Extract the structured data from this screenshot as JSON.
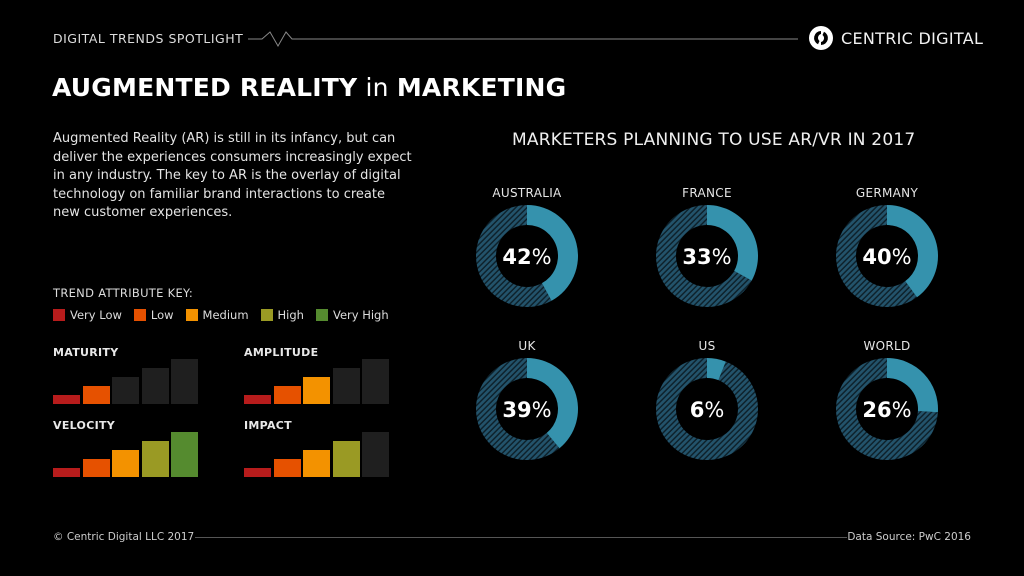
{
  "header": {
    "series_title": "DIGITAL TRENDS SPOTLIGHT",
    "brand_name": "CENTRIC DIGITAL",
    "logo_icon": "centric-digital-logo"
  },
  "title": {
    "bold1": "AUGMENTED REALITY",
    "thin": " in ",
    "bold2": "MARKETING"
  },
  "intro": "Augmented Reality (AR) is still in its infancy, but can deliver the experiences consumers increasingly expect in any industry. The key to AR is the overlay of digital technology on familiar brand interactions to create new customer experiences.",
  "key": {
    "title": "TREND ATTRIBUTE KEY:",
    "levels": [
      {
        "label": "Very Low",
        "color": "#b71c1c"
      },
      {
        "label": "Low",
        "color": "#e65100"
      },
      {
        "label": "Medium",
        "color": "#f39200"
      },
      {
        "label": "High",
        "color": "#9a9a24"
      },
      {
        "label": "Very High",
        "color": "#558b2f"
      }
    ],
    "inactive_color": "#1f1f1f"
  },
  "attributes": [
    {
      "name": "MATURITY",
      "level": 2
    },
    {
      "name": "AMPLITUDE",
      "level": 3
    },
    {
      "name": "VELOCITY",
      "level": 5
    },
    {
      "name": "IMPACT",
      "level": 4
    }
  ],
  "chart_data": {
    "type": "pie",
    "title": "MARKETERS PLANNING TO USE AR/VR IN 2017",
    "categories": [
      "AUSTRALIA",
      "FRANCE",
      "GERMANY",
      "UK",
      "US",
      "WORLD"
    ],
    "values": [
      42,
      33,
      40,
      39,
      6,
      26
    ],
    "unit": "%",
    "colors": {
      "filled": "#3592ad",
      "remaining": "#23536b"
    }
  },
  "footer": {
    "copyright": "© Centric Digital LLC 2017",
    "source": "Data Source: PwC 2016"
  }
}
